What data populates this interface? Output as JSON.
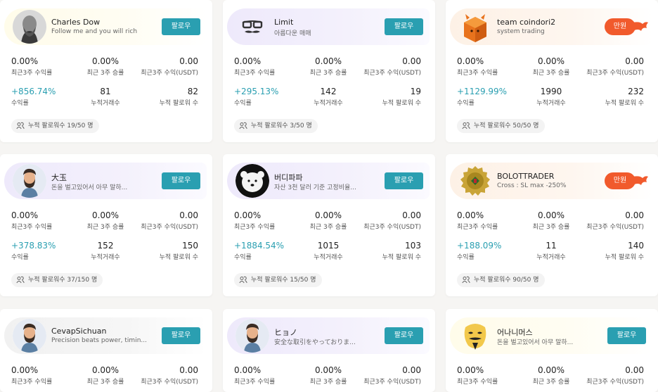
{
  "labels": {
    "stat_3w_return": "최근3주 수익률",
    "stat_3w_winrate": "최근 3주 승률",
    "stat_3w_profit": "최근3주 수익(USDT)",
    "stat_return": "수익률",
    "stat_trades": "누적거래수",
    "stat_followers": "누적 팔로워 수",
    "follower_cap_prefix": "누적 팔로워수"
  },
  "colors": {
    "accent": "#2a9fb1",
    "full": "#f15a2c"
  },
  "cards": [
    {
      "name": "Charles Dow",
      "desc": "Follow me and you will rich",
      "button": "팔로우",
      "full": false,
      "recent_return": "0.00%",
      "recent_winrate": "0.00%",
      "recent_profit": "0.00",
      "total_return": "+856.74%",
      "trades": "81",
      "followers": "82",
      "cap": "19/50 명"
    },
    {
      "name": "Limit",
      "desc": "아름다운 매매",
      "button": "팔로우",
      "full": false,
      "recent_return": "0.00%",
      "recent_winrate": "0.00%",
      "recent_profit": "0.00",
      "total_return": "+295.13%",
      "trades": "142",
      "followers": "19",
      "cap": "3/50 명"
    },
    {
      "name": "team coindori2",
      "desc": "system trading",
      "button": "만원",
      "full": true,
      "recent_return": "0.00%",
      "recent_winrate": "0.00%",
      "recent_profit": "0.00",
      "total_return": "+1129.99%",
      "trades": "1990",
      "followers": "232",
      "cap": "50/50 명"
    },
    {
      "name": "大玉",
      "desc": "돈을 벌고있어서 아무 말하...",
      "button": "팔로우",
      "full": false,
      "recent_return": "0.00%",
      "recent_winrate": "0.00%",
      "recent_profit": "0.00",
      "total_return": "+378.83%",
      "trades": "152",
      "followers": "150",
      "cap": "37/150 명"
    },
    {
      "name": "버디파파",
      "desc": "자산 3천 달러 기준 고정비율...",
      "button": "팔로우",
      "full": false,
      "recent_return": "0.00%",
      "recent_winrate": "0.00%",
      "recent_profit": "0.00",
      "total_return": "+1884.54%",
      "trades": "1015",
      "followers": "103",
      "cap": "15/50 명"
    },
    {
      "name": "BOLOTTRADER",
      "desc": "Cross : SL max -250%",
      "button": "만원",
      "full": true,
      "recent_return": "0.00%",
      "recent_winrate": "0.00%",
      "recent_profit": "0.00",
      "total_return": "+188.09%",
      "trades": "11",
      "followers": "140",
      "cap": "90/50 명"
    },
    {
      "name": "CevapSichuan",
      "desc": "Precision beats power, timin...",
      "button": "팔로우",
      "full": false,
      "recent_return": "0.00%",
      "recent_winrate": "0.00%",
      "recent_profit": "0.00"
    },
    {
      "name": "ヒョノ",
      "desc": "安全な取引をやっておりま...",
      "button": "팔로우",
      "full": false,
      "recent_return": "0.00%",
      "recent_winrate": "0.00%",
      "recent_profit": "0.00"
    },
    {
      "name": "어나니머스",
      "desc": "돈을 벌고있어서 아무 말하...",
      "button": "팔로우",
      "full": false,
      "recent_return": "0.00%",
      "recent_winrate": "0.00%",
      "recent_profit": "0.00"
    }
  ]
}
